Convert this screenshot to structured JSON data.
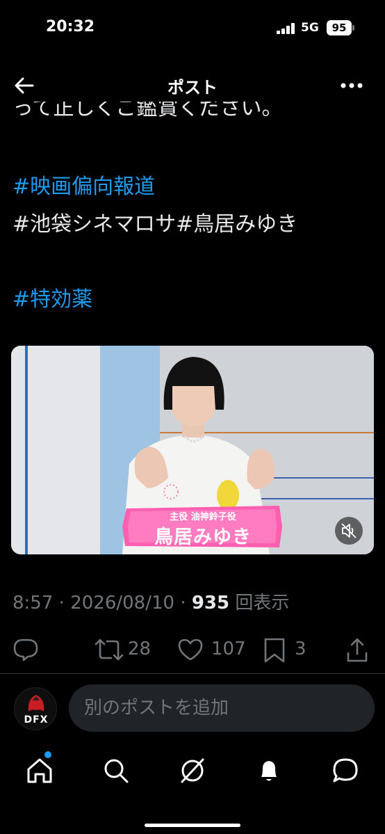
{
  "status": {
    "time": "20:32",
    "network": "5G",
    "battery": "95"
  },
  "nav": {
    "title": "ポスト"
  },
  "tweet": {
    "cut_line": "って正しくご鑑賞ください。",
    "hashtag_1": "#映画偏向報道",
    "line_2": "#池袋シネマロサ#鳥居みゆき",
    "hashtag_2": "#特効薬"
  },
  "media": {
    "caption_role": "主役 油神鈴子役",
    "caption_name": "鳥居みゆき"
  },
  "meta": {
    "time": "8:57",
    "date": "2026/08/10",
    "views_count": "935",
    "views_label": "回表示"
  },
  "actions": {
    "retweets": "28",
    "likes": "107",
    "bookmarks": "3"
  },
  "reply": {
    "avatar_text": "DFX",
    "placeholder": "別のポストを追加"
  },
  "colors": {
    "accent": "#1d9bf0",
    "caption_pink": "#ff5fb0",
    "background": "#000000"
  }
}
